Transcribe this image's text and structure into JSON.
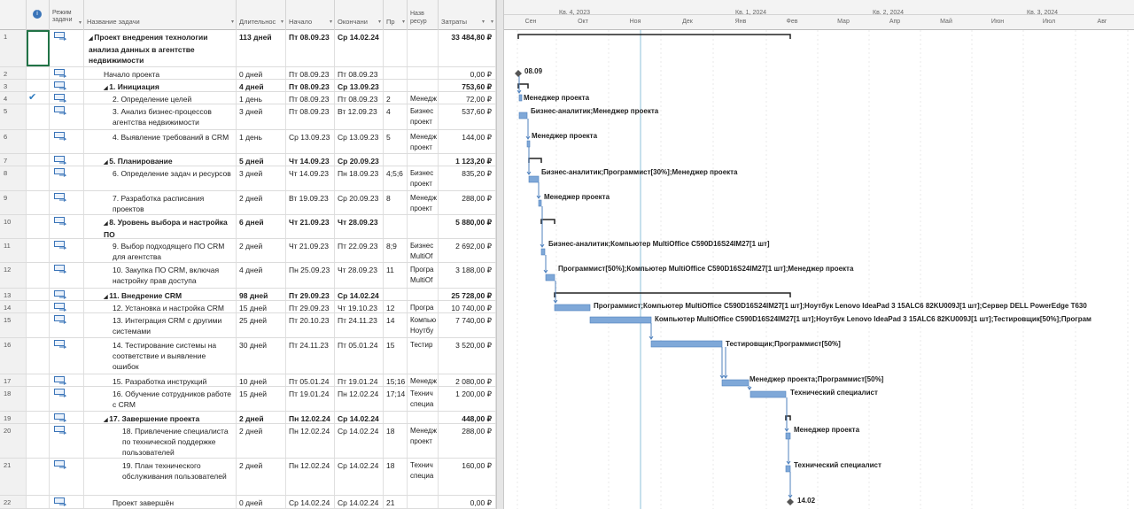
{
  "columns": {
    "info": "i",
    "mode": "Режим задачи",
    "name": "Название задачи",
    "duration": "Длительнос",
    "start": "Начало",
    "finish": "Окончани",
    "pred": "Пр",
    "resources": "Назв ресур",
    "cost": "Затраты"
  },
  "tasks": [
    {
      "id": "1",
      "name": "Проект внедрения технологии анализа данных в агентстве недвижимости",
      "duration": "113 дней",
      "start": "Пт 08.09.23",
      "finish": "Ср 14.02.24",
      "pred": "",
      "res": "",
      "cost": "33 484,80 ₽",
      "summary": true,
      "indent": 0,
      "lines": 3,
      "check": false
    },
    {
      "id": "2",
      "name": "Начало проекта",
      "duration": "0 дней",
      "start": "Пт 08.09.23",
      "finish": "Пт 08.09.23",
      "pred": "",
      "res": "",
      "cost": "0,00 ₽",
      "summary": false,
      "indent": 1,
      "lines": 1,
      "check": false
    },
    {
      "id": "3",
      "name": "1. Инициация",
      "duration": "4 дней",
      "start": "Пт 08.09.23",
      "finish": "Ср 13.09.23",
      "pred": "",
      "res": "",
      "cost": "753,60 ₽",
      "summary": true,
      "indent": 1,
      "lines": 1,
      "check": false
    },
    {
      "id": "4",
      "name": "2. Определение целей",
      "duration": "1 день",
      "start": "Пт 08.09.23",
      "finish": "Пт 08.09.23",
      "pred": "2",
      "res": "Менедж",
      "cost": "72,00 ₽",
      "summary": false,
      "indent": 2,
      "lines": 1,
      "check": true
    },
    {
      "id": "5",
      "name": "3. Анализ бизнес-процессов агентства недвижимости",
      "duration": "3 дней",
      "start": "Пт 08.09.23",
      "finish": "Вт 12.09.23",
      "pred": "4",
      "res": "Бизнес проект",
      "cost": "537,60 ₽",
      "summary": false,
      "indent": 2,
      "lines": 2,
      "check": false
    },
    {
      "id": "6",
      "name": "4. Выявление требований в CRM",
      "duration": "1 день",
      "start": "Ср 13.09.23",
      "finish": "Ср 13.09.23",
      "pred": "5",
      "res": "Менедж проект",
      "cost": "144,00 ₽",
      "summary": false,
      "indent": 2,
      "lines": 2,
      "check": false
    },
    {
      "id": "7",
      "name": "5. Планирование",
      "duration": "5 дней",
      "start": "Чт 14.09.23",
      "finish": "Ср 20.09.23",
      "pred": "",
      "res": "",
      "cost": "1 123,20 ₽",
      "summary": true,
      "indent": 1,
      "lines": 1,
      "check": false
    },
    {
      "id": "8",
      "name": "6. Определение задач и ресурсов",
      "duration": "3 дней",
      "start": "Чт 14.09.23",
      "finish": "Пн 18.09.23",
      "pred": "4;5;6",
      "res": "Бизнес проект",
      "cost": "835,20 ₽",
      "summary": false,
      "indent": 2,
      "lines": 2,
      "check": false
    },
    {
      "id": "9",
      "name": "7. Разработка расписания проектов",
      "duration": "2 дней",
      "start": "Вт 19.09.23",
      "finish": "Ср 20.09.23",
      "pred": "8",
      "res": "Менедж проект",
      "cost": "288,00 ₽",
      "summary": false,
      "indent": 2,
      "lines": 2,
      "check": false
    },
    {
      "id": "10",
      "name": "8. Уровень выбора и настройка ПО",
      "duration": "6 дней",
      "start": "Чт 21.09.23",
      "finish": "Чт 28.09.23",
      "pred": "",
      "res": "",
      "cost": "5 880,00 ₽",
      "summary": true,
      "indent": 1,
      "lines": 2,
      "check": false
    },
    {
      "id": "11",
      "name": "9. Выбор подходящего ПО CRM для агентства",
      "duration": "2 дней",
      "start": "Чт 21.09.23",
      "finish": "Пт 22.09.23",
      "pred": "8;9",
      "res": "Бизнес MultiOf",
      "cost": "2 692,00 ₽",
      "summary": false,
      "indent": 2,
      "lines": 2,
      "check": false
    },
    {
      "id": "12",
      "name": "10. Закупка ПО CRM, включая настройку прав доступа",
      "duration": "4 дней",
      "start": "Пн 25.09.23",
      "finish": "Чт 28.09.23",
      "pred": "11",
      "res": "Програ MultiOf",
      "cost": "3 188,00 ₽",
      "summary": false,
      "indent": 2,
      "lines": 2,
      "check": false
    },
    {
      "id": "13",
      "name": "11. Внедрение CRM",
      "duration": "98 дней",
      "start": "Пт 29.09.23",
      "finish": "Ср 14.02.24",
      "pred": "",
      "res": "",
      "cost": "25 728,00 ₽",
      "summary": true,
      "indent": 1,
      "lines": 1,
      "check": false
    },
    {
      "id": "14",
      "name": "12. Установка и настройка CRM",
      "duration": "15 дней",
      "start": "Пт 29.09.23",
      "finish": "Чт 19.10.23",
      "pred": "12",
      "res": "Програ",
      "cost": "10 740,00 ₽",
      "summary": false,
      "indent": 2,
      "lines": 1,
      "check": false
    },
    {
      "id": "15",
      "name": "13. Интеграция CRM с другими системами",
      "duration": "25 дней",
      "start": "Пт 20.10.23",
      "finish": "Пт 24.11.23",
      "pred": "14",
      "res": "Компью Ноутбу",
      "cost": "7 740,00 ₽",
      "summary": false,
      "indent": 2,
      "lines": 2,
      "check": false
    },
    {
      "id": "16",
      "name": "14. Тестирование системы на соответствие и выявление ошибок",
      "duration": "30 дней",
      "start": "Пт 24.11.23",
      "finish": "Пт 05.01.24",
      "pred": "15",
      "res": "Тестир",
      "cost": "3 520,00 ₽",
      "summary": false,
      "indent": 2,
      "lines": 3,
      "check": false
    },
    {
      "id": "17",
      "name": "15. Разработка инструкций",
      "duration": "10 дней",
      "start": "Пт 05.01.24",
      "finish": "Пт 19.01.24",
      "pred": "15;16",
      "res": "Менедж",
      "cost": "2 080,00 ₽",
      "summary": false,
      "indent": 2,
      "lines": 1,
      "check": false
    },
    {
      "id": "18",
      "name": "16. Обучение сотрудников работе с CRM",
      "duration": "15 дней",
      "start": "Пт 19.01.24",
      "finish": "Пн 12.02.24",
      "pred": "17;14",
      "res": "Технич специа",
      "cost": "1 200,00 ₽",
      "summary": false,
      "indent": 2,
      "lines": 2,
      "check": false
    },
    {
      "id": "19",
      "name": "17. Завершение проекта",
      "duration": "2 дней",
      "start": "Пн 12.02.24",
      "finish": "Ср 14.02.24",
      "pred": "",
      "res": "",
      "cost": "448,00 ₽",
      "summary": true,
      "indent": 1,
      "lines": 1,
      "check": false
    },
    {
      "id": "20",
      "name": "18. Привлечение специалиста по технической поддержке пользователей",
      "duration": "2 дней",
      "start": "Пн 12.02.24",
      "finish": "Ср 14.02.24",
      "pred": "18",
      "res": "Менедж проект",
      "cost": "288,00 ₽",
      "summary": false,
      "indent": 3,
      "lines": 3,
      "check": false
    },
    {
      "id": "21",
      "name": "19. План технического обслуживания пользователей",
      "duration": "2 дней",
      "start": "Пн 12.02.24",
      "finish": "Ср 14.02.24",
      "pred": "18",
      "res": "Технич специа",
      "cost": "160,00 ₽",
      "summary": false,
      "indent": 3,
      "lines": 3,
      "check": false
    },
    {
      "id": "22",
      "name": "Проект завершён",
      "duration": "0 дней",
      "start": "Ср 14.02.24",
      "finish": "Ср 14.02.24",
      "pred": "21",
      "res": "",
      "cost": "0,00 ₽",
      "summary": false,
      "indent": 2,
      "lines": 1,
      "check": false
    }
  ],
  "timescale": {
    "quarters": [
      "Кв. 4, 2023",
      "Кв. 1, 2024",
      "Кв. 2, 2024",
      "Кв. 3, 2024"
    ],
    "months": [
      "Сен",
      "Окт",
      "Ноя",
      "Дек",
      "Янв",
      "Фев",
      "Мар",
      "Апр",
      "Май",
      "Июн",
      "Июл",
      "Авг"
    ]
  },
  "gantt_labels": {
    "milestone_start": "08.09",
    "milestone_end": "14.02",
    "r4": "Менеджер проекта",
    "r5": "Бизнес-аналитик;Менеджер проекта",
    "r6": "Менеджер проекта",
    "r8": "Бизнес-аналитик;Программист[30%];Менеджер проекта",
    "r9": "Менеджер проекта",
    "r11": "Бизнес-аналитик;Компьютер MultiOffice C590D16S24IM27[1 шт]",
    "r12": "Программист[50%];Компьютер MultiOffice C590D16S24IM27[1 шт];Менеджер проекта",
    "r14": "Программист;Компьютер MultiOffice C590D16S24IM27[1 шт];Ноутбук Lenovo IdeaPad 3 15ALC6 82KU009J[1 шт];Сервер DELL PowerEdge T630",
    "r15": "Компьютер MultiOffice C590D16S24IM27[1 шт];Ноутбук Lenovo IdeaPad 3 15ALC6 82KU009J[1 шт];Тестировщик[50%];Програм",
    "r16": "Тестировщик;Программист[50%]",
    "r17": "Менеджер проекта;Программист[50%]",
    "r18": "Технический специалист",
    "r20": "Менеджер проекта",
    "r21": "Технический специалист"
  },
  "colors": {
    "bar": "#7fa8d8",
    "bar_border": "#4f81bd",
    "summary": "#222222",
    "today": "#8ec1d9"
  }
}
